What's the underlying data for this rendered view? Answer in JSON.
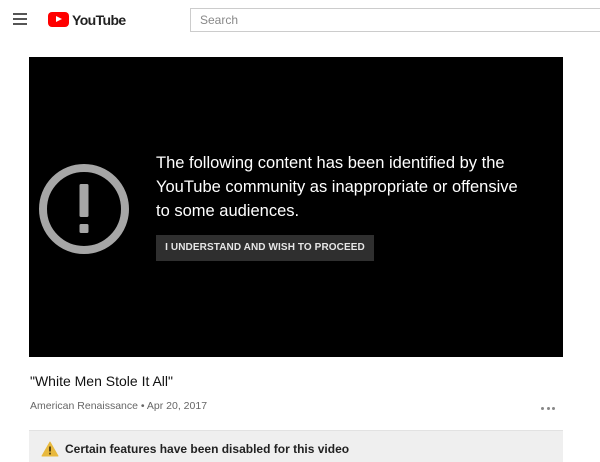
{
  "header": {
    "menu_icon": "hamburger-menu-icon",
    "logo_text": "YouTube",
    "logo_color": "#ff0000",
    "search": {
      "placeholder": "Search",
      "value": ""
    }
  },
  "player": {
    "background": "#000000",
    "warning_icon": "exclamation-circle-icon",
    "message": "The following content has been identified by the\nYouTube community as inappropriate or offensive\nto some audiences.",
    "proceed_label": "I UNDERSTAND AND WISH TO PROCEED"
  },
  "video": {
    "title": "\"White Men Stole It All\"",
    "channel": "American Renaissance",
    "separator": " • ",
    "date": "Apr 20, 2017",
    "more_icon": "more-options-icon"
  },
  "banner": {
    "icon": "warning-triangle-icon",
    "icon_color": "#e8b93e",
    "text": "Certain features have been disabled for this video"
  }
}
